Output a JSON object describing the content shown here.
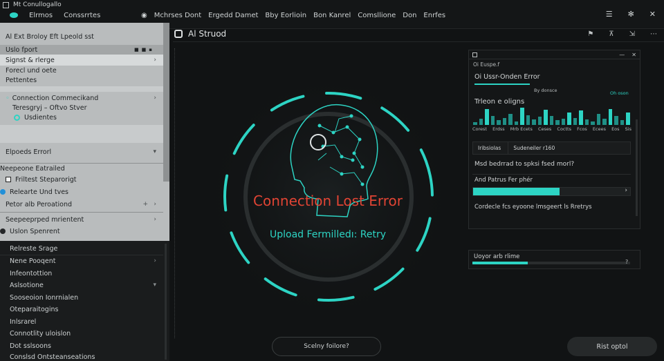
{
  "app": {
    "window_title": "Mt Conullogallo",
    "tabs": [
      "Elrmos",
      "Conssrrtes",
      "Mchrses Dont",
      "Ergedd Damet",
      "Bby Eorlioin",
      "Bon Kanrel",
      "Comsllione",
      "Don",
      "Enrfes"
    ]
  },
  "left_panel": {
    "header": "Al Ext Broloy Eft Lpeold sst",
    "subheader": "Uslo fport",
    "items": [
      {
        "label": "Signst & rlerge"
      },
      {
        "label": "Forecl und oete"
      },
      {
        "label": "Pettentes"
      },
      {
        "label": "Connection Commecikand"
      },
      {
        "label": "Teresgryj – Oftvo Stver"
      },
      {
        "label": "Usdientes"
      },
      {
        "label": "Elpoeds Errorl"
      },
      {
        "label": "Neepeone Eatrailed"
      },
      {
        "label": "Friltest Steparorigt"
      },
      {
        "label": "Relearte Und tves"
      },
      {
        "label": "Petor alb Peroationd"
      },
      {
        "label": "Seepeeprped mrientent"
      },
      {
        "label": "Uslon Spenrent"
      }
    ],
    "dark_items": [
      {
        "label": "Relreste Srage"
      },
      {
        "label": "Nene Pooqent"
      },
      {
        "label": "Infeontottion"
      },
      {
        "label": "Aslsotione"
      },
      {
        "label": "Sooseoion Ionrnialen"
      },
      {
        "label": "Oteparaitogins"
      },
      {
        "label": "Inlsrarel"
      },
      {
        "label": "Connotlity uloislon"
      },
      {
        "label": "Dot sslsoons"
      },
      {
        "label": "Conslsd Ontsteanseations"
      }
    ]
  },
  "main": {
    "title": "Al Struod",
    "error_title": "Connection Lost Error",
    "error_sub": "Upload Fermilledı: Retry",
    "retry_button": "Scelny foilore?",
    "option_button": "Rist optol"
  },
  "right_panel": {
    "header": "Oi Euspe.f",
    "title": "Oi Ussr-Onden Error",
    "caption_right": "By donsce",
    "caption_teal": "Oh oson",
    "chart_title": "Trleon e oligns",
    "x_labels": [
      "Corest",
      "Erdss",
      "Mrb Ecets",
      "Ceses",
      "Coctts",
      "Fcos",
      "Ecees",
      "Eos",
      "Sis"
    ],
    "bar_levels": [
      0.15,
      0.35,
      0.9,
      0.5,
      0.25,
      0.4,
      0.6,
      0.2,
      0.95,
      0.55,
      0.3,
      0.45,
      0.85,
      0.5,
      0.25,
      0.35,
      0.7,
      0.4,
      0.8,
      0.3,
      0.2,
      0.6,
      0.35,
      0.9,
      0.5,
      0.25,
      0.7
    ],
    "tab_active": "Iribsiolas",
    "tab_other": "Sudeneiler  r160",
    "question": "Msd bedrrad to spksi fsed morl?",
    "progress_label": "And Patrus Fer phér",
    "progress_value": 0.55,
    "footer_text": "Cordecle fcs eyoone lmsgeert ls Rretrys",
    "update_label": "Uoyor arb rlime",
    "update_progress": 0.35
  },
  "colors": {
    "accent": "#2dd4c4",
    "error": "#e14434",
    "background": "#111314"
  }
}
